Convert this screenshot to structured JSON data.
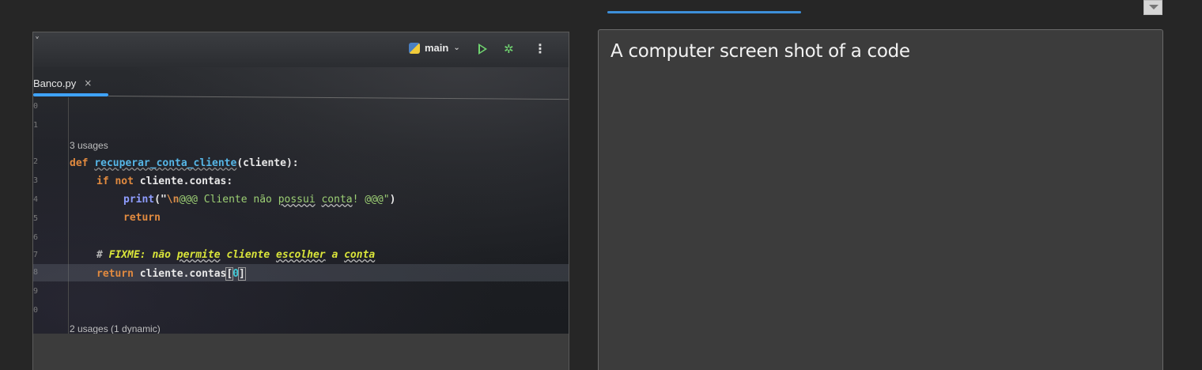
{
  "caption": {
    "text": "A computer screen shot of a code"
  },
  "ide": {
    "branch": "main",
    "file_tab": "Banco.py",
    "close_glyph": "×",
    "collapse_glyph": "˅",
    "dropdown_glyph": "⌄",
    "more_glyph": "⋮",
    "debug_glyph": "✲",
    "line_numbers": [
      "0",
      "1",
      "2",
      "3",
      "4",
      "5",
      "6",
      "7",
      "8",
      "9",
      "0"
    ],
    "hint_top": "3 usages",
    "hint_bottom": "2 usages (1 dynamic)",
    "code": {
      "line1_kw": "def ",
      "line1_fn": "recuperar_conta_cliente",
      "line1_rest": "(cliente):",
      "line2_kw": "if not ",
      "line2_rest": "cliente.contas:",
      "line3_bi": "print",
      "line3_open": "(\"",
      "line3_esc": "\\n",
      "line3_str1": "@@@ Cliente não ",
      "line3_w1": "possui",
      "line3_w2": "conta",
      "line3_str2": "! @@@\"",
      "line3_close": ")",
      "line4_kw": "return",
      "line5_hash": "# ",
      "line5_todo": "FIXME: não ",
      "line5_w1": "permite",
      "line5_mid": " cliente ",
      "line5_w2": "escolher",
      "line5_a": " a ",
      "line5_w3": "conta",
      "line6_kw": "return ",
      "line6_rest": "cliente.contas",
      "line6_ob": "[",
      "line6_num": "0",
      "line6_cb": "]"
    }
  },
  "colors": {
    "accent": "#3d8fd9",
    "keyword": "#e18a3f",
    "function": "#56b6e6",
    "string": "#9ccf74",
    "todo": "#d9e43a"
  }
}
